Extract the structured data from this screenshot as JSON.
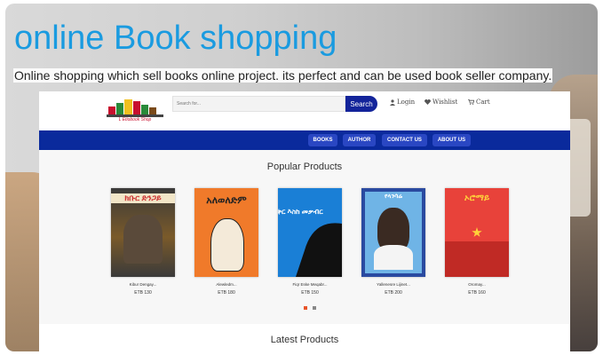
{
  "page": {
    "title": "online Book shopping",
    "subtitle": "Online shopping which sell books online project. its perfect and can be used book seller company."
  },
  "site": {
    "logo_text": "L Etiobook Shop",
    "search": {
      "placeholder": "Search for...",
      "button": "Search"
    },
    "links": {
      "login": "Login",
      "wishlist": "Wishlist",
      "cart": "Cart"
    },
    "nav": [
      "BOOKS",
      "AUTHOR",
      "CONTACT US",
      "ABOUT US"
    ],
    "popular_title": "Popular Products",
    "latest_title": "Latest Products",
    "products": [
      {
        "name": "Kibur Dengay...",
        "price": "ETB 130",
        "cover_text": "ክቡር ድንጋይ",
        "colors": [
          "#3a3a3a",
          "#7a5a2a",
          "#c33"
        ]
      },
      {
        "name": "Alewledm...",
        "price": "ETB 180",
        "cover_text": "አለወለድም",
        "colors": [
          "#f07a2a",
          "#e8832f",
          "#2b2b2b"
        ]
      },
      {
        "name": "Fiqr Eske Meqabr...",
        "price": "ETB 150",
        "cover_text": "ፍቅር እስከ መቃብር",
        "colors": [
          "#1a7fd6",
          "#111111",
          "#ffffff"
        ]
      },
      {
        "name": "Yallenesre Lijinet...",
        "price": "ETB 200",
        "cover_text": "የላንሳሬ",
        "colors": [
          "#6fb4e6",
          "#2a4aa0",
          "#ffffff"
        ]
      },
      {
        "name": "Oromay...",
        "price": "ETB 160",
        "cover_text": "ኦሮማይ",
        "colors": [
          "#e8423a",
          "#c02a25",
          "#ffd23a"
        ]
      }
    ]
  }
}
